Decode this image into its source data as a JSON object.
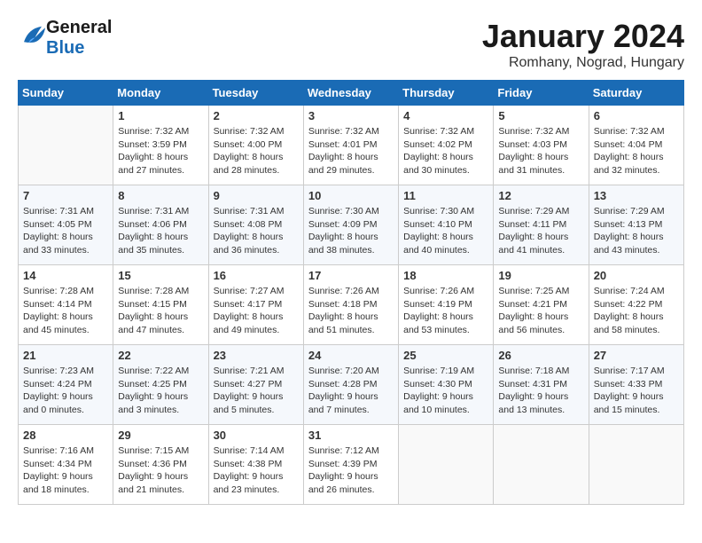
{
  "header": {
    "logo_line1": "General",
    "logo_line2": "Blue",
    "month_year": "January 2024",
    "location": "Romhany, Nograd, Hungary"
  },
  "days_of_week": [
    "Sunday",
    "Monday",
    "Tuesday",
    "Wednesday",
    "Thursday",
    "Friday",
    "Saturday"
  ],
  "weeks": [
    [
      {
        "day": "",
        "info": ""
      },
      {
        "day": "1",
        "info": "Sunrise: 7:32 AM\nSunset: 3:59 PM\nDaylight: 8 hours\nand 27 minutes."
      },
      {
        "day": "2",
        "info": "Sunrise: 7:32 AM\nSunset: 4:00 PM\nDaylight: 8 hours\nand 28 minutes."
      },
      {
        "day": "3",
        "info": "Sunrise: 7:32 AM\nSunset: 4:01 PM\nDaylight: 8 hours\nand 29 minutes."
      },
      {
        "day": "4",
        "info": "Sunrise: 7:32 AM\nSunset: 4:02 PM\nDaylight: 8 hours\nand 30 minutes."
      },
      {
        "day": "5",
        "info": "Sunrise: 7:32 AM\nSunset: 4:03 PM\nDaylight: 8 hours\nand 31 minutes."
      },
      {
        "day": "6",
        "info": "Sunrise: 7:32 AM\nSunset: 4:04 PM\nDaylight: 8 hours\nand 32 minutes."
      }
    ],
    [
      {
        "day": "7",
        "info": "Sunrise: 7:31 AM\nSunset: 4:05 PM\nDaylight: 8 hours\nand 33 minutes."
      },
      {
        "day": "8",
        "info": "Sunrise: 7:31 AM\nSunset: 4:06 PM\nDaylight: 8 hours\nand 35 minutes."
      },
      {
        "day": "9",
        "info": "Sunrise: 7:31 AM\nSunset: 4:08 PM\nDaylight: 8 hours\nand 36 minutes."
      },
      {
        "day": "10",
        "info": "Sunrise: 7:30 AM\nSunset: 4:09 PM\nDaylight: 8 hours\nand 38 minutes."
      },
      {
        "day": "11",
        "info": "Sunrise: 7:30 AM\nSunset: 4:10 PM\nDaylight: 8 hours\nand 40 minutes."
      },
      {
        "day": "12",
        "info": "Sunrise: 7:29 AM\nSunset: 4:11 PM\nDaylight: 8 hours\nand 41 minutes."
      },
      {
        "day": "13",
        "info": "Sunrise: 7:29 AM\nSunset: 4:13 PM\nDaylight: 8 hours\nand 43 minutes."
      }
    ],
    [
      {
        "day": "14",
        "info": "Sunrise: 7:28 AM\nSunset: 4:14 PM\nDaylight: 8 hours\nand 45 minutes."
      },
      {
        "day": "15",
        "info": "Sunrise: 7:28 AM\nSunset: 4:15 PM\nDaylight: 8 hours\nand 47 minutes."
      },
      {
        "day": "16",
        "info": "Sunrise: 7:27 AM\nSunset: 4:17 PM\nDaylight: 8 hours\nand 49 minutes."
      },
      {
        "day": "17",
        "info": "Sunrise: 7:26 AM\nSunset: 4:18 PM\nDaylight: 8 hours\nand 51 minutes."
      },
      {
        "day": "18",
        "info": "Sunrise: 7:26 AM\nSunset: 4:19 PM\nDaylight: 8 hours\nand 53 minutes."
      },
      {
        "day": "19",
        "info": "Sunrise: 7:25 AM\nSunset: 4:21 PM\nDaylight: 8 hours\nand 56 minutes."
      },
      {
        "day": "20",
        "info": "Sunrise: 7:24 AM\nSunset: 4:22 PM\nDaylight: 8 hours\nand 58 minutes."
      }
    ],
    [
      {
        "day": "21",
        "info": "Sunrise: 7:23 AM\nSunset: 4:24 PM\nDaylight: 9 hours\nand 0 minutes."
      },
      {
        "day": "22",
        "info": "Sunrise: 7:22 AM\nSunset: 4:25 PM\nDaylight: 9 hours\nand 3 minutes."
      },
      {
        "day": "23",
        "info": "Sunrise: 7:21 AM\nSunset: 4:27 PM\nDaylight: 9 hours\nand 5 minutes."
      },
      {
        "day": "24",
        "info": "Sunrise: 7:20 AM\nSunset: 4:28 PM\nDaylight: 9 hours\nand 7 minutes."
      },
      {
        "day": "25",
        "info": "Sunrise: 7:19 AM\nSunset: 4:30 PM\nDaylight: 9 hours\nand 10 minutes."
      },
      {
        "day": "26",
        "info": "Sunrise: 7:18 AM\nSunset: 4:31 PM\nDaylight: 9 hours\nand 13 minutes."
      },
      {
        "day": "27",
        "info": "Sunrise: 7:17 AM\nSunset: 4:33 PM\nDaylight: 9 hours\nand 15 minutes."
      }
    ],
    [
      {
        "day": "28",
        "info": "Sunrise: 7:16 AM\nSunset: 4:34 PM\nDaylight: 9 hours\nand 18 minutes."
      },
      {
        "day": "29",
        "info": "Sunrise: 7:15 AM\nSunset: 4:36 PM\nDaylight: 9 hours\nand 21 minutes."
      },
      {
        "day": "30",
        "info": "Sunrise: 7:14 AM\nSunset: 4:38 PM\nDaylight: 9 hours\nand 23 minutes."
      },
      {
        "day": "31",
        "info": "Sunrise: 7:12 AM\nSunset: 4:39 PM\nDaylight: 9 hours\nand 26 minutes."
      },
      {
        "day": "",
        "info": ""
      },
      {
        "day": "",
        "info": ""
      },
      {
        "day": "",
        "info": ""
      }
    ]
  ]
}
